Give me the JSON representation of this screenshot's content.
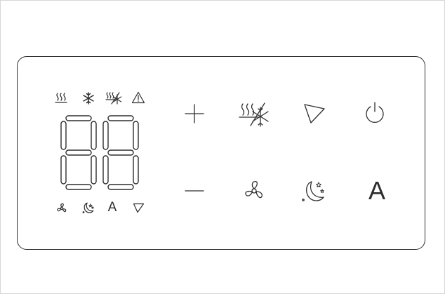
{
  "display": {
    "digits": [
      "8",
      "8"
    ],
    "top_indicators": [
      "heat-icon",
      "snowflake-icon",
      "defrost-icon",
      "warning-icon"
    ],
    "bottom_indicators": [
      "fan-icon",
      "sleep-icon",
      "auto-letter",
      "swing-icon"
    ],
    "auto_indicator_text": "A"
  },
  "buttons": {
    "row_top": [
      "plus-button",
      "mode-button",
      "swing-button",
      "power-button"
    ],
    "row_bottom": [
      "minus-button",
      "fan-button",
      "sleep-button",
      "auto-button"
    ],
    "auto_label": "A"
  },
  "colors": {
    "stroke": "#2e2e2e",
    "panel_border": "#2e2e2e",
    "frame_border": "#d6d6d6",
    "background": "#ffffff"
  }
}
